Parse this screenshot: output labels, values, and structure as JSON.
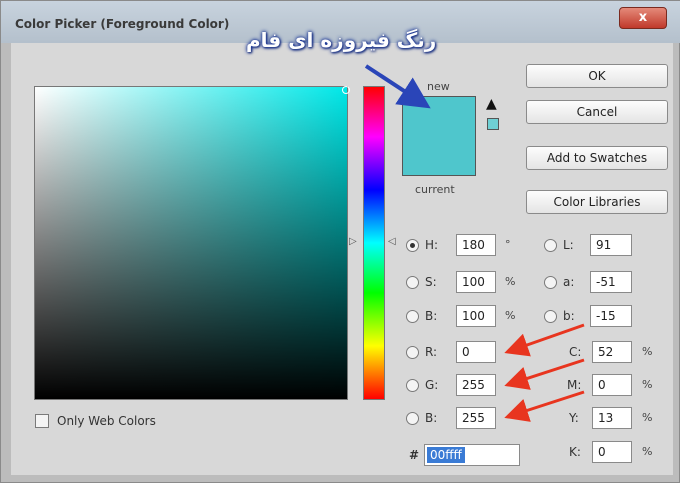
{
  "window": {
    "title": "Color Picker (Foreground Color)",
    "close_label": "x"
  },
  "annotation": {
    "text": "رنگ فیروزه ای فام"
  },
  "preview": {
    "new_label": "new",
    "current_label": "current",
    "new_color": "#4fc6cc",
    "current_color": "#4fc6cc"
  },
  "buttons": {
    "ok": "OK",
    "cancel": "Cancel",
    "add_swatches": "Add to Swatches",
    "color_libraries": "Color Libraries"
  },
  "hsb": {
    "h": {
      "label": "H:",
      "value": "180",
      "unit": "°",
      "selected": true
    },
    "s": {
      "label": "S:",
      "value": "100",
      "unit": "%"
    },
    "b": {
      "label": "B:",
      "value": "100",
      "unit": "%"
    }
  },
  "rgb": {
    "r": {
      "label": "R:",
      "value": "0"
    },
    "g": {
      "label": "G:",
      "value": "255"
    },
    "b": {
      "label": "B:",
      "value": "255"
    }
  },
  "lab": {
    "l": {
      "label": "L:",
      "value": "91"
    },
    "a": {
      "label": "a:",
      "value": "-51"
    },
    "b": {
      "label": "b:",
      "value": "-15"
    }
  },
  "cmyk": {
    "c": {
      "label": "C:",
      "value": "52",
      "unit": "%"
    },
    "m": {
      "label": "M:",
      "value": "0",
      "unit": "%"
    },
    "y": {
      "label": "Y:",
      "value": "13",
      "unit": "%"
    },
    "k": {
      "label": "K:",
      "value": "0",
      "unit": "%"
    }
  },
  "hex": {
    "label": "#",
    "value": "00ffff"
  },
  "only_web_colors": {
    "label": "Only Web Colors",
    "checked": false
  },
  "colors": {
    "accent_arrow_red": "#e8351f",
    "accent_arrow_blue": "#2a45b8"
  }
}
